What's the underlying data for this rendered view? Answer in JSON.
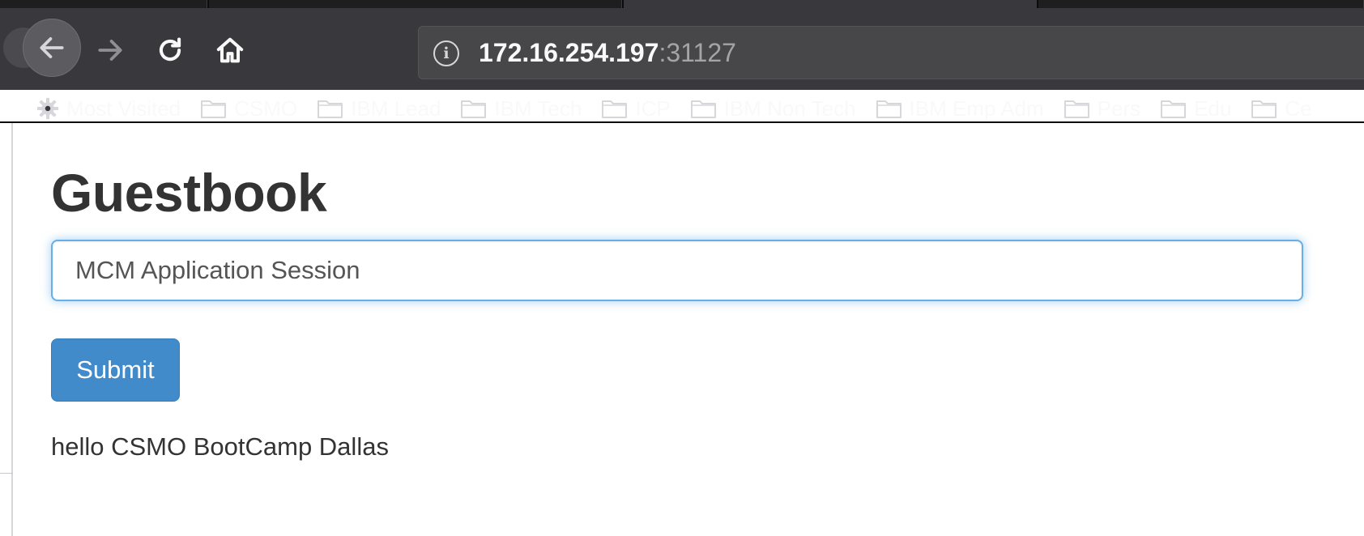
{
  "browser": {
    "url": {
      "host": "172.16.254.197",
      "port": ":31127"
    },
    "icons": {
      "back": "arrow-left-icon",
      "forward": "arrow-right-icon",
      "reload": "reload-icon",
      "home": "home-icon",
      "site_info": "info-icon",
      "bookmark_folder": "folder-icon",
      "most_visited": "gear-icon"
    },
    "bookmarks": [
      {
        "label": "Most Visited",
        "icon": "gear-icon"
      },
      {
        "label": "CSMO",
        "icon": "folder-icon"
      },
      {
        "label": "IBM Lead",
        "icon": "folder-icon"
      },
      {
        "label": "IBM Tech",
        "icon": "folder-icon"
      },
      {
        "label": "ICP",
        "icon": "folder-icon"
      },
      {
        "label": "IBM Non Tech",
        "icon": "folder-icon"
      },
      {
        "label": "IBM Emp Adm",
        "icon": "folder-icon"
      },
      {
        "label": "Pers",
        "icon": "folder-icon"
      },
      {
        "label": "Edu",
        "icon": "folder-icon"
      },
      {
        "label": "Ce",
        "icon": "folder-icon"
      }
    ],
    "colors": {
      "toolbar": "#38383d",
      "urlbar": "#474749",
      "tabstrip": "#0c0c0d"
    }
  },
  "page": {
    "title": "Guestbook",
    "input": {
      "value": "MCM Application Session"
    },
    "submit_label": "Submit",
    "entries": [
      "hello CSMO BootCamp Dallas"
    ],
    "colors": {
      "accent": "#428bca",
      "focus_ring": "#66afe9",
      "text": "#333333"
    }
  }
}
